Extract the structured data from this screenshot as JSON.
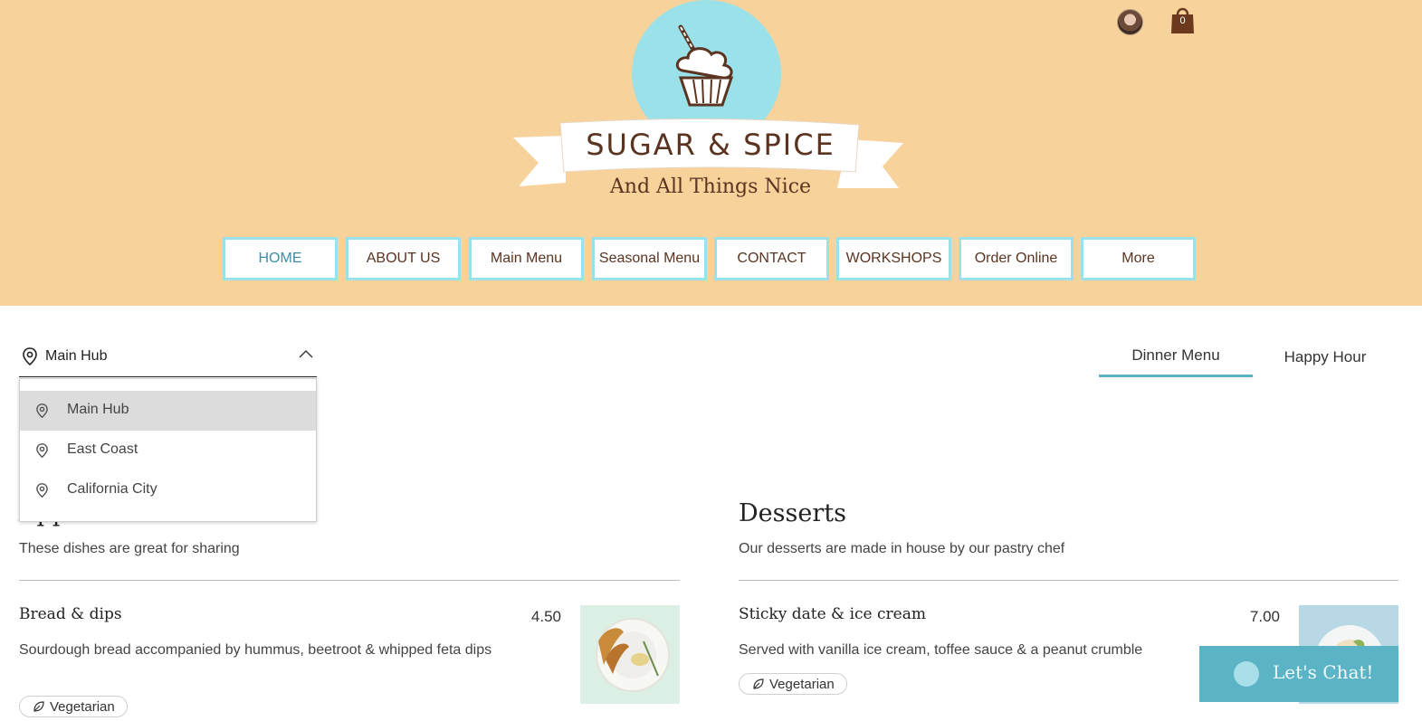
{
  "brand": {
    "name": "SUGAR & SPICE",
    "tagline": "And All Things Nice"
  },
  "header": {
    "cart_count": "0"
  },
  "nav": {
    "items": [
      {
        "label": "HOME",
        "active": true
      },
      {
        "label": "ABOUT US"
      },
      {
        "label": "Main Menu"
      },
      {
        "label": "Seasonal Menu"
      },
      {
        "label": "CONTACT"
      },
      {
        "label": "WORKSHOPS"
      },
      {
        "label": "Order Online"
      },
      {
        "label": "More"
      }
    ]
  },
  "location": {
    "selected": "Main Hub",
    "options": [
      "Main Hub",
      "East Coast",
      "California City"
    ]
  },
  "menu_tabs": [
    {
      "label": "Dinner Menu",
      "active": true
    },
    {
      "label": "Happy Hour"
    }
  ],
  "sections": [
    {
      "title": "Appetizers",
      "description": "These dishes are great for sharing",
      "items": [
        {
          "name": "Bread & dips",
          "price": "4.50",
          "description": "Sourdough bread accompanied by hummus, beetroot & whipped feta dips",
          "tag": "Vegetarian"
        }
      ]
    },
    {
      "title": "Desserts",
      "description": "Our desserts are made in house by our pastry chef",
      "items": [
        {
          "name": "Sticky date & ice cream",
          "price": "7.00",
          "description": "Served with vanilla ice cream, toffee sauce & a peanut crumble",
          "tag": "Vegetarian"
        }
      ]
    }
  ],
  "chat": {
    "label": "Let's Chat!"
  },
  "colors": {
    "header_bg": "#f8d29b",
    "accent_teal": "#9be1ea",
    "brand_brown": "#5b3421",
    "chat_bg": "#5ab4c6"
  }
}
